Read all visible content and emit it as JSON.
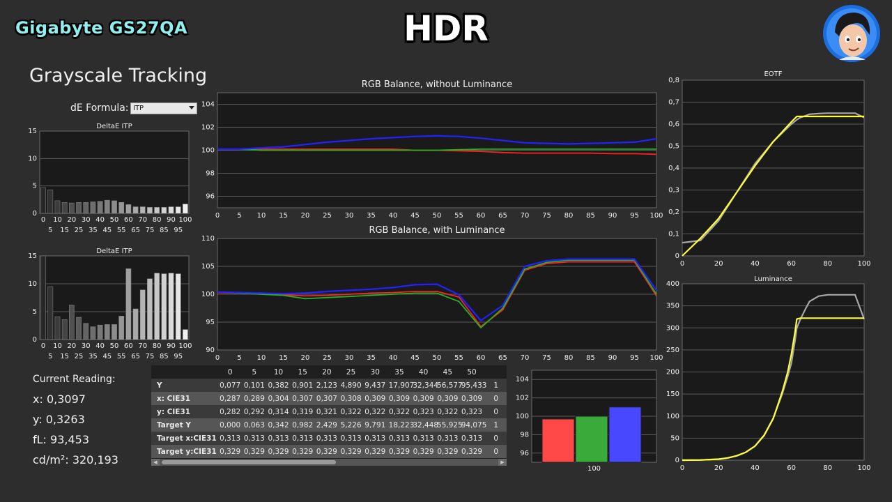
{
  "header": {
    "brand": "Gigabyte GS27QA",
    "mode": "HDR"
  },
  "section_title": "Grayscale Tracking",
  "formula": {
    "label": "dE Formula:",
    "value": "ITP"
  },
  "reading": {
    "title": "Current Reading:",
    "x": "x: 0,3097",
    "y": "y: 0,3263",
    "fl": "fL: 93,453",
    "cdm2": "cd/m²: 320,193"
  },
  "colors": {
    "red": "#ff2222",
    "green": "#22b422",
    "blue": "#2222ff",
    "yellow": "#ffff33",
    "gray": "#a8a8a8"
  },
  "table": {
    "columns": [
      "0",
      "5",
      "10",
      "15",
      "20",
      "25",
      "30",
      "35",
      "40",
      "45",
      "50",
      ""
    ],
    "rows": [
      {
        "label": "Y",
        "values": [
          "0,077",
          "0,101",
          "0,382",
          "0,901",
          "2,123",
          "4,890",
          "9,437",
          "17,907",
          "32,344",
          "56,577",
          "95,433",
          "1"
        ]
      },
      {
        "label": "x: CIE31",
        "values": [
          "0,287",
          "0,289",
          "0,304",
          "0,307",
          "0,307",
          "0,308",
          "0,309",
          "0,309",
          "0,309",
          "0,309",
          "0,309",
          "0"
        ]
      },
      {
        "label": "y: CIE31",
        "values": [
          "0,282",
          "0,292",
          "0,314",
          "0,319",
          "0,321",
          "0,322",
          "0,322",
          "0,322",
          "0,323",
          "0,322",
          "0,323",
          "0"
        ]
      },
      {
        "label": "Target Y",
        "values": [
          "0,000",
          "0,063",
          "0,342",
          "0,982",
          "2,429",
          "5,226",
          "9,791",
          "18,223",
          "32,448",
          "55,925",
          "94,075",
          "1"
        ]
      },
      {
        "label": "Target x:CIE31",
        "values": [
          "0,313",
          "0,313",
          "0,313",
          "0,313",
          "0,313",
          "0,313",
          "0,313",
          "0,313",
          "0,313",
          "0,313",
          "0,313",
          "0"
        ]
      },
      {
        "label": "Target y:CIE31",
        "values": [
          "0,329",
          "0,329",
          "0,329",
          "0,329",
          "0,329",
          "0,329",
          "0,329",
          "0,329",
          "0,329",
          "0,329",
          "0,329",
          "0"
        ]
      }
    ]
  },
  "chart_data": [
    {
      "id": "deltae-top",
      "type": "bar",
      "title": "DeltaE ITP",
      "categories": [
        0,
        5,
        10,
        15,
        20,
        25,
        30,
        35,
        40,
        45,
        50,
        55,
        60,
        65,
        70,
        75,
        80,
        85,
        90,
        95,
        100
      ],
      "x_ticks_upper": [
        "0",
        "10",
        "20",
        "30",
        "40",
        "50",
        "60",
        "70",
        "80",
        "90",
        "100"
      ],
      "x_ticks_lower": [
        "5",
        "15",
        "25",
        "35",
        "45",
        "55",
        "65",
        "75",
        "85",
        "95"
      ],
      "values": [
        4.7,
        4.3,
        2.3,
        2.0,
        1.9,
        2.0,
        2.0,
        2.1,
        2.2,
        2.4,
        2.3,
        2.0,
        1.6,
        1.2,
        1.2,
        1.1,
        1.1,
        1.1,
        1.2,
        1.2,
        1.7
      ],
      "ylim": [
        0,
        15
      ],
      "yticks": [
        "0",
        "5",
        "10",
        "15"
      ],
      "grid": true
    },
    {
      "id": "deltae-bottom",
      "type": "bar",
      "title": "DeltaE ITP",
      "categories": [
        0,
        5,
        10,
        15,
        20,
        25,
        30,
        35,
        40,
        45,
        50,
        55,
        60,
        65,
        70,
        75,
        80,
        85,
        90,
        95,
        100
      ],
      "x_ticks_upper": [
        "0",
        "10",
        "20",
        "30",
        "40",
        "50",
        "60",
        "70",
        "80",
        "90",
        "100"
      ],
      "x_ticks_lower": [
        "5",
        "15",
        "25",
        "35",
        "45",
        "55",
        "65",
        "75",
        "85",
        "95"
      ],
      "values": [
        15,
        9.5,
        4.1,
        3.6,
        6.2,
        4.0,
        2.9,
        2.3,
        2.6,
        2.7,
        2.7,
        4.2,
        12.7,
        5.5,
        8.9,
        10.9,
        11.9,
        11.8,
        11.9,
        11.8,
        1.8
      ],
      "ylim": [
        0,
        15
      ],
      "yticks": [
        "0",
        "5",
        "10",
        "15"
      ],
      "grid": true
    },
    {
      "id": "rgb-no-lum",
      "type": "line",
      "title": "RGB Balance, without Luminance",
      "x": [
        0,
        5,
        10,
        15,
        20,
        25,
        30,
        35,
        40,
        45,
        50,
        55,
        60,
        65,
        70,
        75,
        80,
        85,
        90,
        95,
        100
      ],
      "xticks": [
        "0",
        "5",
        "10",
        "15",
        "20",
        "25",
        "30",
        "35",
        "40",
        "45",
        "50",
        "55",
        "60",
        "65",
        "70",
        "75",
        "80",
        "85",
        "90",
        "95",
        "100"
      ],
      "ylim": [
        95,
        105
      ],
      "yticks": [
        "96",
        "98",
        "100",
        "102",
        "104"
      ],
      "grid": true,
      "series": [
        {
          "color": "red",
          "values": [
            100.1,
            100.1,
            100.1,
            100.1,
            100.1,
            100.1,
            100.1,
            100.1,
            100.1,
            100.0,
            100.0,
            99.95,
            99.9,
            99.8,
            99.75,
            99.75,
            99.75,
            99.75,
            99.7,
            99.7,
            99.65
          ]
        },
        {
          "color": "green",
          "values": [
            100.1,
            100.1,
            100.0,
            100.0,
            100.0,
            100.0,
            100.0,
            100.0,
            100.0,
            100.0,
            100.0,
            100.05,
            100.1,
            100.1,
            100.1,
            100.1,
            100.1,
            100.1,
            100.1,
            100.1,
            100.1
          ]
        },
        {
          "color": "blue",
          "values": [
            100.1,
            100.1,
            100.2,
            100.3,
            100.5,
            100.7,
            100.85,
            101.0,
            101.1,
            101.2,
            101.25,
            101.2,
            101.05,
            100.85,
            100.65,
            100.6,
            100.55,
            100.6,
            100.65,
            100.7,
            101.0
          ]
        }
      ]
    },
    {
      "id": "rgb-lum",
      "type": "line",
      "title": "RGB Balance, with Luminance",
      "x": [
        0,
        5,
        10,
        15,
        20,
        25,
        30,
        35,
        40,
        45,
        50,
        55,
        60,
        65,
        70,
        75,
        80,
        85,
        90,
        95,
        100
      ],
      "xticks": [
        "0",
        "5",
        "10",
        "15",
        "20",
        "25",
        "30",
        "35",
        "40",
        "45",
        "50",
        "55",
        "60",
        "65",
        "70",
        "75",
        "80",
        "85",
        "90",
        "95",
        "100"
      ],
      "ylim": [
        90,
        110
      ],
      "yticks": [
        "90",
        "95",
        "100",
        "105",
        "110"
      ],
      "grid": true,
      "series": [
        {
          "color": "red",
          "values": [
            100.3,
            100.2,
            100.0,
            99.9,
            99.7,
            99.8,
            100.0,
            100.2,
            100.3,
            100.5,
            100.5,
            99.5,
            94.2,
            97.2,
            104.3,
            105.5,
            105.8,
            105.8,
            105.8,
            105.8,
            99.7
          ]
        },
        {
          "color": "green",
          "values": [
            100.4,
            100.2,
            100.0,
            99.8,
            99.2,
            99.4,
            99.6,
            99.8,
            100.0,
            100.2,
            100.2,
            98.7,
            94.0,
            97.5,
            104.5,
            105.7,
            106.1,
            106.1,
            106.1,
            106.1,
            100.0
          ]
        },
        {
          "color": "blue",
          "values": [
            100.4,
            100.3,
            100.2,
            100.1,
            100.2,
            100.5,
            100.7,
            100.9,
            101.2,
            101.7,
            101.8,
            99.9,
            95.3,
            98.0,
            105.0,
            106.0,
            106.3,
            106.3,
            106.3,
            106.3,
            100.7
          ]
        }
      ]
    },
    {
      "id": "eotf",
      "type": "line",
      "title": "EOTF",
      "x": [
        0,
        10,
        20,
        30,
        40,
        50,
        60,
        63,
        65,
        70,
        75,
        80,
        85,
        90,
        95,
        100
      ],
      "xticks": [
        "0",
        "20",
        "40",
        "60",
        "80",
        "100"
      ],
      "ylim": [
        0,
        0.8
      ],
      "yticks": [
        "0",
        "0,1",
        "0,2",
        "0,3",
        "0,4",
        "0,5",
        "0,6",
        "0,7",
        "0,8"
      ],
      "grid": true,
      "series": [
        {
          "color": "gray",
          "values": [
            0.06,
            0.07,
            0.16,
            0.29,
            0.42,
            0.52,
            0.6,
            0.62,
            0.63,
            0.645,
            0.648,
            0.65,
            0.65,
            0.65,
            0.65,
            0.63
          ]
        },
        {
          "color": "yellow",
          "values": [
            0.0,
            0.08,
            0.17,
            0.29,
            0.41,
            0.52,
            0.61,
            0.635,
            0.635,
            0.635,
            0.635,
            0.635,
            0.635,
            0.635,
            0.635,
            0.635
          ]
        }
      ]
    },
    {
      "id": "luminance",
      "type": "line",
      "title": "Luminance",
      "x": [
        0,
        10,
        20,
        25,
        30,
        35,
        40,
        45,
        50,
        55,
        58,
        60,
        62,
        63,
        65,
        68,
        70,
        75,
        80,
        85,
        90,
        95,
        100
      ],
      "xticks": [
        "0",
        "20",
        "40",
        "60",
        "80",
        "100"
      ],
      "ylim": [
        0,
        400
      ],
      "yticks": [
        "0",
        "50",
        "100",
        "150",
        "200",
        "250",
        "300",
        "350",
        "400"
      ],
      "grid": true,
      "series": [
        {
          "color": "gray",
          "values": [
            0,
            0.5,
            2,
            5,
            10,
            18,
            32,
            57,
            95,
            150,
            190,
            220,
            270,
            300,
            320,
            345,
            360,
            372,
            375,
            375,
            375,
            375,
            320
          ]
        },
        {
          "color": "yellow",
          "values": [
            0,
            0.3,
            2.4,
            5,
            10,
            18,
            32,
            56,
            94,
            155,
            200,
            240,
            290,
            320,
            322,
            322,
            322,
            322,
            322,
            322,
            322,
            322,
            322
          ]
        }
      ]
    },
    {
      "id": "rgb-bars",
      "type": "bar",
      "categories": [
        "100"
      ],
      "series": [
        {
          "color": "red",
          "values": [
            99.7
          ]
        },
        {
          "color": "green",
          "values": [
            100.0
          ]
        },
        {
          "color": "blue",
          "values": [
            101.0
          ]
        }
      ],
      "ylim": [
        95,
        105
      ],
      "yticks": [
        "96",
        "98",
        "100",
        "102",
        "104"
      ],
      "grid": true
    }
  ]
}
